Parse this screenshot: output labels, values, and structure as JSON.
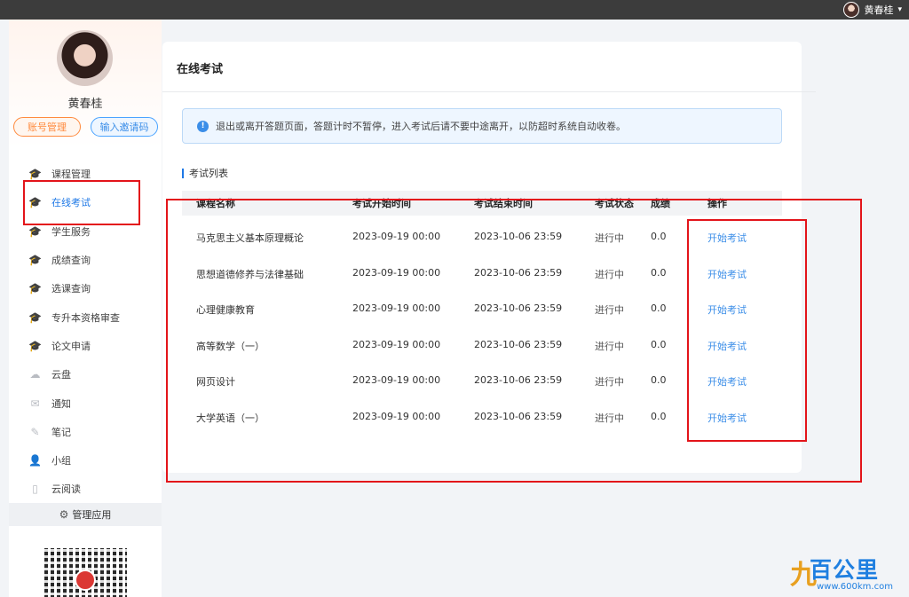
{
  "topbar": {
    "user_name": "黄春桂",
    "caret": "▾"
  },
  "sidebar": {
    "user_name": "黄春桂",
    "account_button": "账号管理",
    "invite_button": "输入邀请码",
    "menu": [
      {
        "label": "课程管理",
        "icon": "graduation-cap-icon",
        "glyph": "🎓"
      },
      {
        "label": "在线考试",
        "icon": "graduation-cap-icon",
        "glyph": "🎓",
        "active": true
      },
      {
        "label": "学生服务",
        "icon": "graduation-cap-icon",
        "glyph": "🎓"
      },
      {
        "label": "成绩查询",
        "icon": "graduation-cap-icon",
        "glyph": "🎓"
      },
      {
        "label": "选课查询",
        "icon": "graduation-cap-icon",
        "glyph": "🎓"
      },
      {
        "label": "专升本资格审查",
        "icon": "graduation-cap-icon",
        "glyph": "🎓"
      },
      {
        "label": "论文申请",
        "icon": "graduation-cap-icon",
        "glyph": "🎓"
      },
      {
        "label": "云盘",
        "icon": "cloud-icon",
        "glyph": "☁"
      },
      {
        "label": "通知",
        "icon": "mail-icon",
        "glyph": "✉"
      },
      {
        "label": "笔记",
        "icon": "note-icon",
        "glyph": "✎"
      },
      {
        "label": "小组",
        "icon": "person-icon",
        "glyph": "👤"
      },
      {
        "label": "云阅读",
        "icon": "book-icon",
        "glyph": "▯"
      }
    ],
    "manage_apps": "管理应用"
  },
  "main": {
    "title": "在线考试",
    "notice": "退出或离开答题页面，答题计时不暂停，进入考试后请不要中途离开，以防超时系统自动收卷。",
    "section_title": "考试列表",
    "columns": [
      "课程名称",
      "考试开始时间",
      "考试结束时间",
      "考试状态",
      "成绩",
      "操作"
    ],
    "rows": [
      {
        "course": "马克思主义基本原理概论",
        "start": "2023-09-19 00:00",
        "end": "2023-10-06 23:59",
        "status": "进行中",
        "score": "0.0",
        "action": "开始考试"
      },
      {
        "course": "思想道德修养与法律基础",
        "start": "2023-09-19 00:00",
        "end": "2023-10-06 23:59",
        "status": "进行中",
        "score": "0.0",
        "action": "开始考试"
      },
      {
        "course": "心理健康教育",
        "start": "2023-09-19 00:00",
        "end": "2023-10-06 23:59",
        "status": "进行中",
        "score": "0.0",
        "action": "开始考试"
      },
      {
        "course": "高等数学（一）",
        "start": "2023-09-19 00:00",
        "end": "2023-10-06 23:59",
        "status": "进行中",
        "score": "0.0",
        "action": "开始考试"
      },
      {
        "course": "网页设计",
        "start": "2023-09-19 00:00",
        "end": "2023-10-06 23:59",
        "status": "进行中",
        "score": "0.0",
        "action": "开始考试"
      },
      {
        "course": "大学英语（一）",
        "start": "2023-09-19 00:00",
        "end": "2023-10-06 23:59",
        "status": "进行中",
        "score": "0.0",
        "action": "开始考试"
      }
    ]
  },
  "watermark": {
    "text": "百公里",
    "url": "www.600km.com"
  },
  "colors": {
    "accent": "#1e78e6",
    "annotation": "#e3141a",
    "link": "#3b8ee8"
  }
}
